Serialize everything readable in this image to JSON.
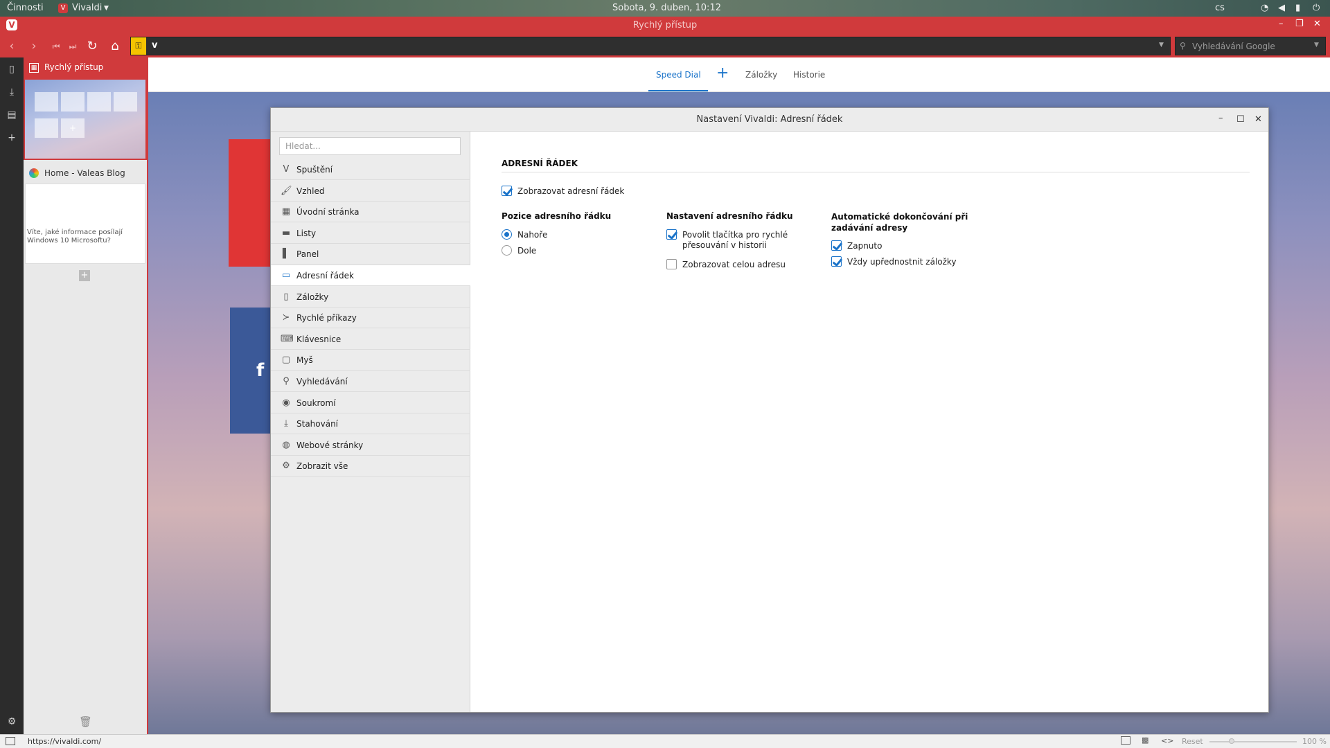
{
  "topbar": {
    "activities": "Činnosti",
    "app": "Vivaldi",
    "clock": "Sobota,  9. duben, 10:12",
    "lang": "cs"
  },
  "window": {
    "title": "Rychlý přístup"
  },
  "search": {
    "placeholder": "Vyhledávání Google"
  },
  "tabs": [
    {
      "label": "Rychlý přístup"
    },
    {
      "label": "Home - Valeas Blog",
      "snippet": "Víte, jaké informace posílají Windows 10 Microsoftu?"
    }
  ],
  "page_tabs": {
    "speed_dial": "Speed Dial",
    "add": "+",
    "bookmarks": "Záložky",
    "history": "Historie"
  },
  "dialog": {
    "title": "Nastavení Vivaldi: Adresní řádek",
    "search_placeholder": "Hledat...",
    "menu": [
      {
        "label": "Spuštění",
        "icon": "vivaldi-icon"
      },
      {
        "label": "Vzhled",
        "icon": "paint-icon"
      },
      {
        "label": "Úvodní stránka",
        "icon": "grid-icon"
      },
      {
        "label": "Listy",
        "icon": "tabs-icon"
      },
      {
        "label": "Panel",
        "icon": "panel-icon"
      },
      {
        "label": "Adresní řádek",
        "icon": "address-bar-icon",
        "active": true
      },
      {
        "label": "Záložky",
        "icon": "bookmark-icon"
      },
      {
        "label": "Rychlé příkazy",
        "icon": "command-icon"
      },
      {
        "label": "Klávesnice",
        "icon": "keyboard-icon"
      },
      {
        "label": "Myš",
        "icon": "mouse-icon"
      },
      {
        "label": "Vyhledávání",
        "icon": "search-icon"
      },
      {
        "label": "Soukromí",
        "icon": "eye-icon"
      },
      {
        "label": "Stahování",
        "icon": "download-icon"
      },
      {
        "label": "Webové stránky",
        "icon": "globe-icon"
      },
      {
        "label": "Zobrazit vše",
        "icon": "gear-icon"
      }
    ],
    "section_title": "ADRESNÍ ŘÁDEK",
    "show_address_bar": {
      "label": "Zobrazovat adresní řádek",
      "checked": true
    },
    "position": {
      "title": "Pozice adresního řádku",
      "options": [
        {
          "label": "Nahoře",
          "selected": true
        },
        {
          "label": "Dole",
          "selected": false
        }
      ]
    },
    "settings": {
      "title": "Nastavení adresního řádku",
      "opt1": "Povolit tlačítka pro rychlé přesouvání v historii",
      "opt1_checked": true,
      "opt2": "Zobrazovat celou adresu",
      "opt2_checked": false
    },
    "autocomplete": {
      "title": "Automatické dokončování při zadávání adresy",
      "opt1": "Zapnuto",
      "opt2": "Vždy upřednostnit záložky"
    }
  },
  "status": {
    "url": "https://vivaldi.com/",
    "reset": "Reset",
    "zoom": "100 %"
  },
  "colors": {
    "accent": "#d03a3c",
    "blue": "#1a73c9"
  }
}
